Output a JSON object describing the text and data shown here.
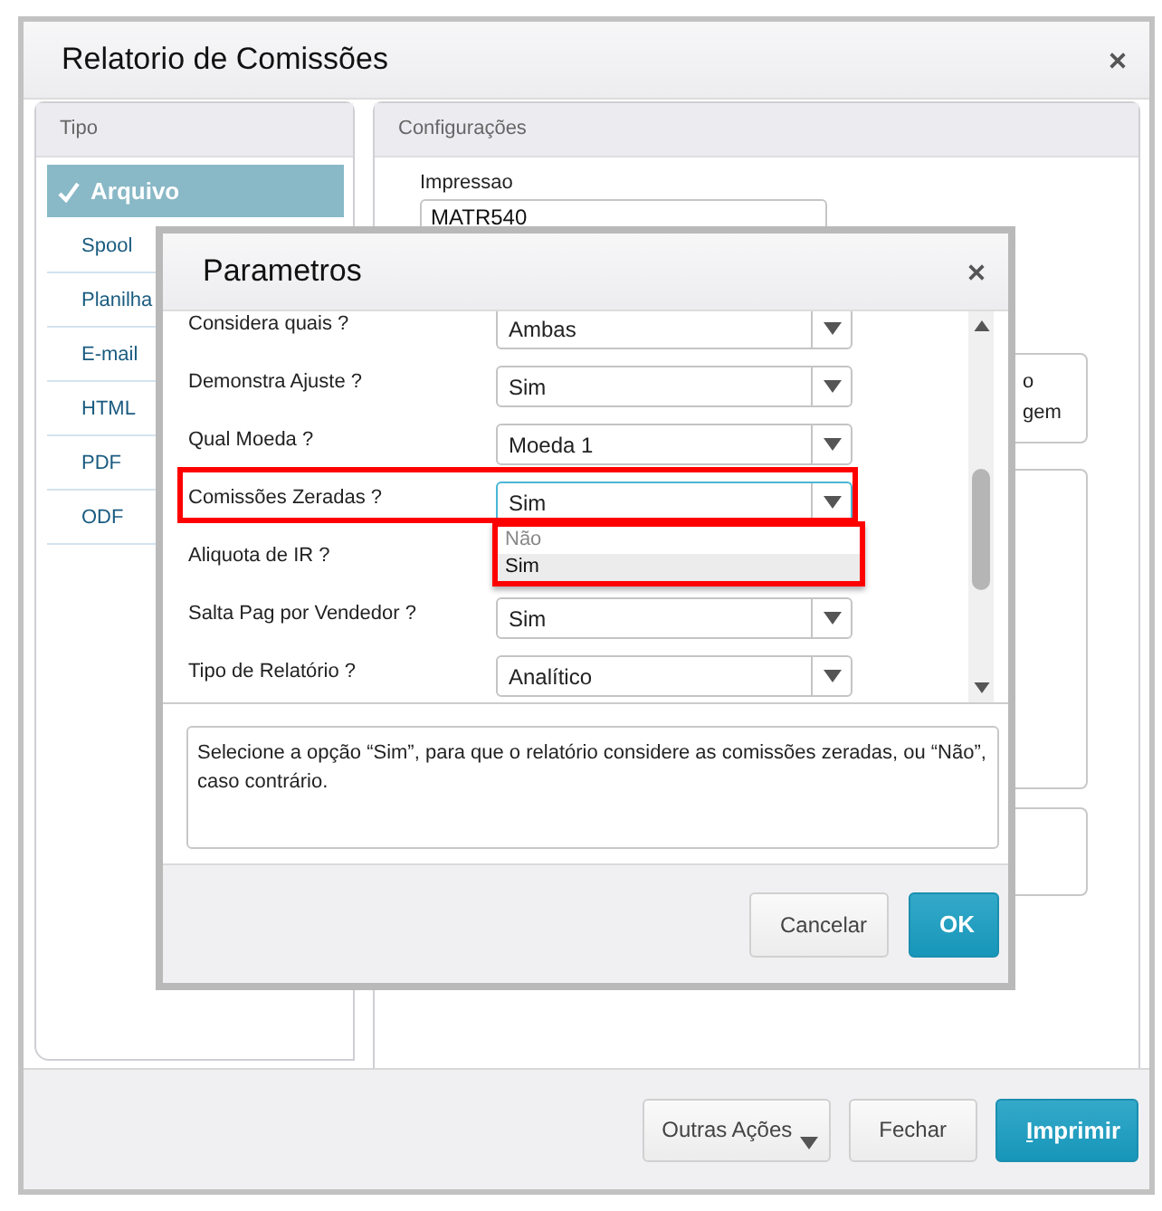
{
  "window": {
    "title": "Relatorio de Comissões"
  },
  "tipo_panel": {
    "title": "Tipo",
    "items": [
      {
        "label": "Arquivo",
        "selected": true
      },
      {
        "label": "Spool",
        "selected": false
      },
      {
        "label": "Planilha",
        "selected": false
      },
      {
        "label": "E-mail",
        "selected": false
      },
      {
        "label": "HTML",
        "selected": false
      },
      {
        "label": "PDF",
        "selected": false
      },
      {
        "label": "ODF",
        "selected": false
      }
    ]
  },
  "config_panel": {
    "title": "Configurações",
    "impressao": {
      "label": "Impressao",
      "value": "MATR540"
    },
    "card_texts": [
      "o",
      "gem"
    ]
  },
  "footer_buttons": [
    {
      "label": "Outras Ações",
      "kind": "menu"
    },
    {
      "label": "Fechar",
      "kind": "default"
    },
    {
      "label": "Imprimir",
      "kind": "primary",
      "underline_first": true
    }
  ],
  "dialog": {
    "title": "Parametros",
    "params": [
      {
        "label": "Considera quais ?",
        "value": "Ambas"
      },
      {
        "label": "Demonstra Ajuste ?",
        "value": "Sim"
      },
      {
        "label": "Qual Moeda ?",
        "value": "Moeda 1"
      },
      {
        "label": "Comissões Zeradas ?",
        "value": "Sim",
        "focused": true,
        "highlighted": true,
        "options": [
          {
            "label": "Não",
            "selected": false
          },
          {
            "label": "Sim",
            "selected": true
          }
        ]
      },
      {
        "label": "Aliquota de IR ?"
      },
      {
        "label": "Salta Pag por Vendedor ?",
        "value": "Sim"
      },
      {
        "label": "Tipo de Relatório ?",
        "value": "Analítico"
      }
    ],
    "help": "Selecione a opção “Sim”, para que o relatório considere as comissões zeradas, ou “Não”, caso contrário.",
    "buttons": [
      {
        "label": "Cancelar",
        "kind": "default"
      },
      {
        "label": "OK",
        "kind": "primary"
      }
    ]
  }
}
